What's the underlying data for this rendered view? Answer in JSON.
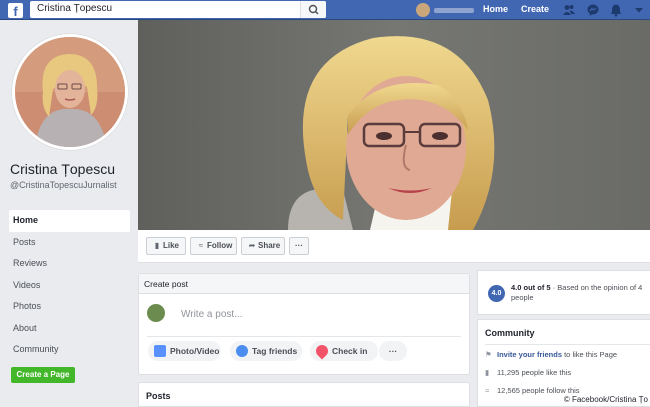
{
  "topbar": {
    "logo_glyph": "f",
    "search_value": "Cristina Țopescu",
    "links": [
      "Home",
      "Create"
    ],
    "icons": [
      "friends-icon",
      "messenger-icon",
      "notifications-icon",
      "dropdown-icon"
    ]
  },
  "profile": {
    "name": "Cristina Țopescu",
    "handle": "@CristinaTopescuJurnalist"
  },
  "nav": {
    "items": [
      "Home",
      "Posts",
      "Reviews",
      "Videos",
      "Photos",
      "About",
      "Community"
    ],
    "active": "Home",
    "create_page": "Create a Page"
  },
  "actions": {
    "like": "Like",
    "follow": "Follow",
    "share": "Share",
    "more": "···"
  },
  "create_post": {
    "title": "Create post",
    "placeholder": "Write a post...",
    "photo_video": "Photo/Video",
    "tag_friends": "Tag friends",
    "check_in": "Check in",
    "more": "···"
  },
  "posts": {
    "title": "Posts"
  },
  "rating": {
    "badge": "4.0",
    "score": "4.0 out of 5",
    "separator": " · ",
    "based": "Based on the opinion of 4",
    "people": "people"
  },
  "community": {
    "title": "Community",
    "invite_link": "Invite your friends",
    "invite_rest": " to like this Page",
    "likes": "11,295 people like this",
    "follows": "12,565 people follow this"
  },
  "credit": "© Facebook/Cristina Țo",
  "colors": {
    "brand_blue": "#4267b2",
    "create_green": "#42b72a",
    "background": "#e9ebee"
  }
}
